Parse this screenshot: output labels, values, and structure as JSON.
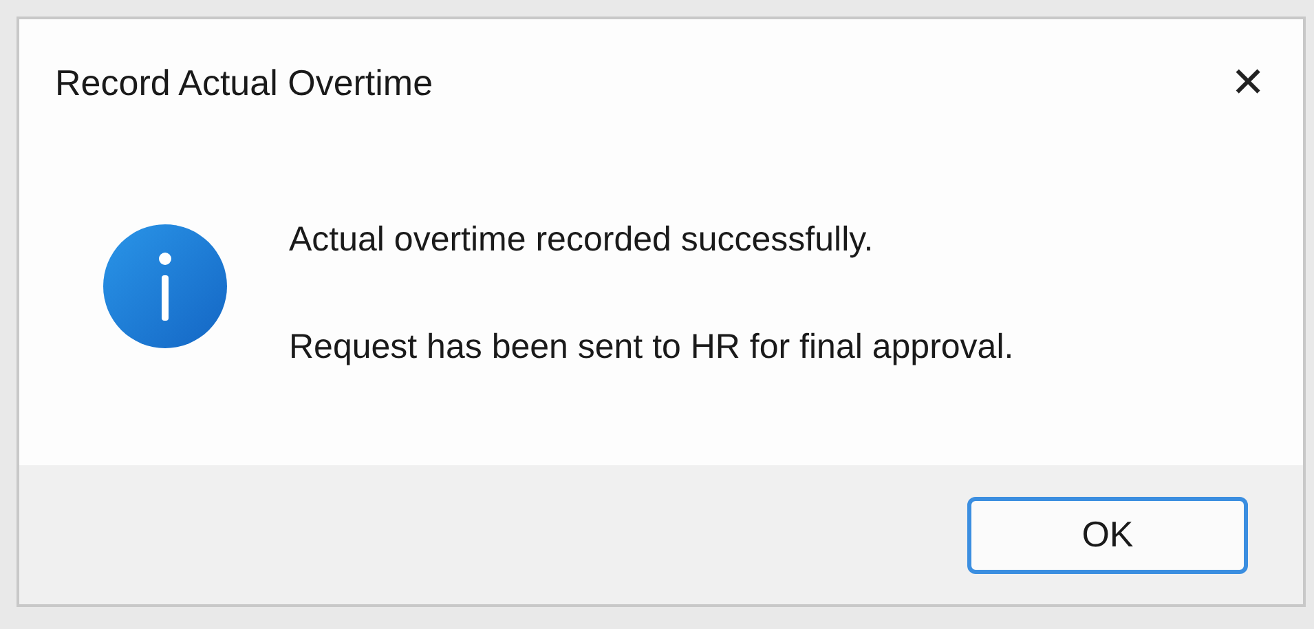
{
  "dialog": {
    "title": "Record Actual Overtime",
    "close": "✕",
    "messages": [
      "Actual overtime recorded successfully.",
      "Request has been sent to HR for final approval."
    ],
    "buttons": [
      {
        "label": "OK",
        "selected": true
      }
    ]
  }
}
